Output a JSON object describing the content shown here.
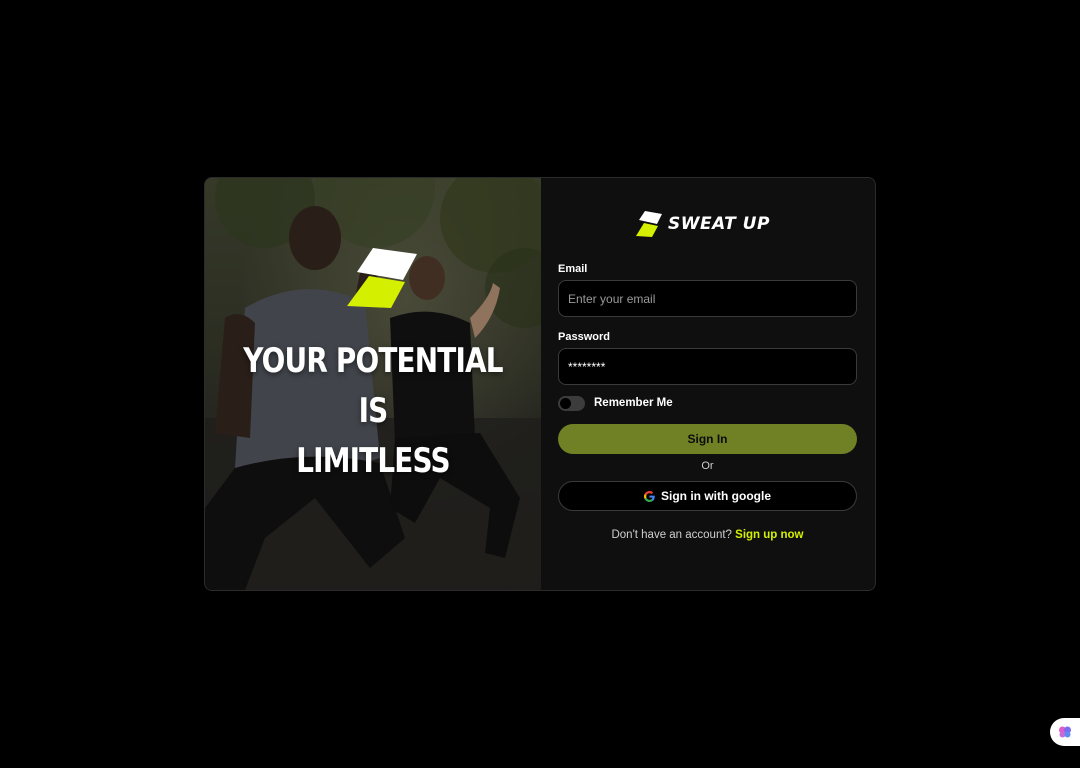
{
  "brand": {
    "name": "SWEAT UP",
    "accent_color": "#d4f000",
    "logo_icon": "sweat-up-logo-icon"
  },
  "hero": {
    "title_line1": "YOUR POTENTIAL IS",
    "title_line2": "LIMITLESS"
  },
  "form": {
    "email_label": "Email",
    "email_placeholder": "Enter your email",
    "email_value": "",
    "password_label": "Password",
    "password_value": "********",
    "remember_label": "Remember Me",
    "remember_checked": false,
    "signin_label": "Sign In",
    "or_text": "Or",
    "google_label": "Sign in with google",
    "signup_prompt": "Don't have an account?",
    "signup_link": "Sign up now"
  },
  "colors": {
    "signin_button": "#6f8124",
    "background": "#000000",
    "card": "#0f0f0f"
  },
  "floating_widget": {
    "icon": "brain-icon"
  }
}
